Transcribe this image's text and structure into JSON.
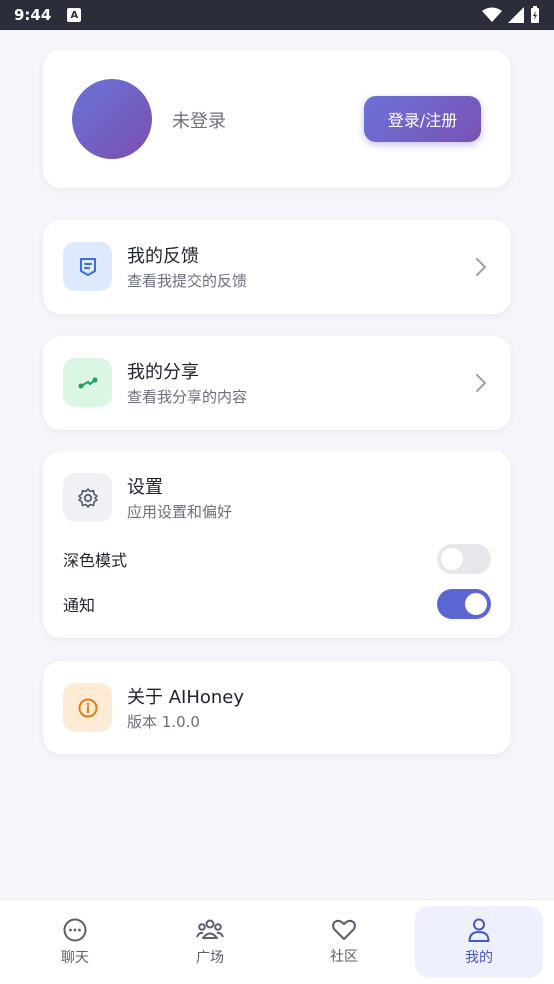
{
  "status_bar": {
    "time": "9:44",
    "notification_letter": "A"
  },
  "profile": {
    "status_text": "未登录",
    "login_button_label": "登录/注册"
  },
  "menu": {
    "feedback": {
      "title": "我的反馈",
      "subtitle": "查看我提交的反馈",
      "icon": "feedback-icon",
      "icon_bg": "#dfe9fd",
      "icon_color": "#3b6fd8"
    },
    "share": {
      "title": "我的分享",
      "subtitle": "查看我分享的内容",
      "icon": "share-icon",
      "icon_bg": "#dcf6e5",
      "icon_color": "#1ea05a"
    }
  },
  "settings": {
    "title": "设置",
    "subtitle": "应用设置和偏好",
    "icon": "gear-icon",
    "dark_mode": {
      "label": "深色模式",
      "enabled": false
    },
    "notifications": {
      "label": "通知",
      "enabled": true
    }
  },
  "about": {
    "title": "关于 AIHoney",
    "version": "版本 1.0.0",
    "icon": "info-icon",
    "icon_bg": "#fdebd6",
    "icon_color": "#e07b1a"
  },
  "bottom_nav": {
    "items": [
      {
        "label": "聊天",
        "icon": "chat-icon",
        "active": false
      },
      {
        "label": "广场",
        "icon": "group-icon",
        "active": false
      },
      {
        "label": "社区",
        "icon": "heart-icon",
        "active": false
      },
      {
        "label": "我的",
        "icon": "user-icon",
        "active": true
      }
    ]
  },
  "colors": {
    "accent": "#5b67d3",
    "toggle_on": "#5b67d3",
    "toggle_off": "#e6e7eb"
  }
}
